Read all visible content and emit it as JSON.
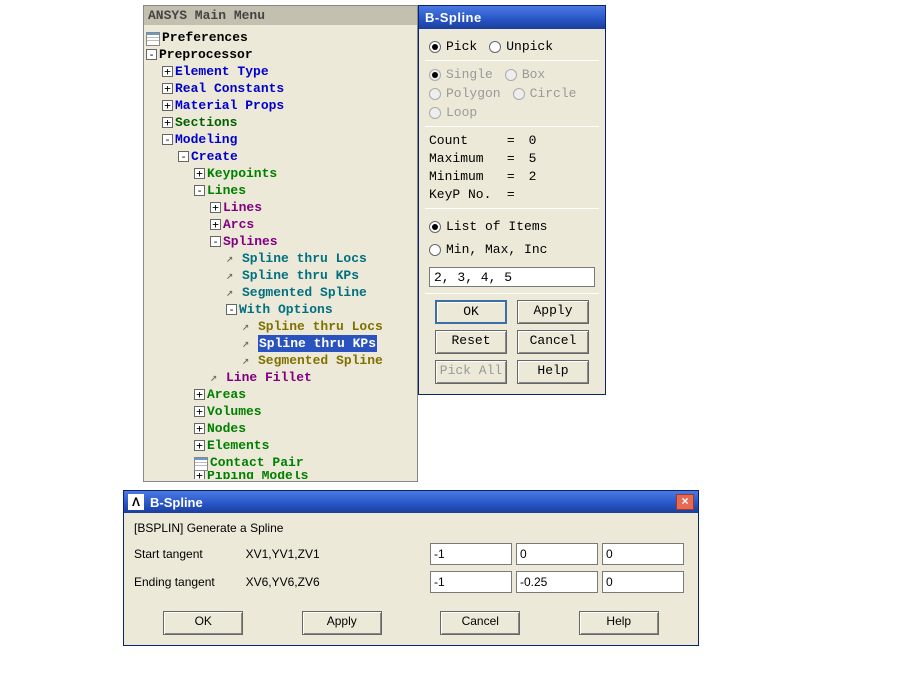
{
  "tree": {
    "title": "ANSYS Main Menu",
    "nodes": [
      {
        "depth": 0,
        "exp": "",
        "icon": "page",
        "label": "Preferences",
        "color": "c-black"
      },
      {
        "depth": 0,
        "exp": "-",
        "icon": "",
        "label": "Preprocessor",
        "color": "c-black"
      },
      {
        "depth": 1,
        "exp": "+",
        "icon": "",
        "label": "Element Type",
        "color": "c-blue"
      },
      {
        "depth": 1,
        "exp": "+",
        "icon": "",
        "label": "Real Constants",
        "color": "c-blue"
      },
      {
        "depth": 1,
        "exp": "+",
        "icon": "",
        "label": "Material Props",
        "color": "c-blue"
      },
      {
        "depth": 1,
        "exp": "+",
        "icon": "",
        "label": "Sections",
        "color": "c-darkgreen"
      },
      {
        "depth": 1,
        "exp": "-",
        "icon": "",
        "label": "Modeling",
        "color": "c-blue"
      },
      {
        "depth": 2,
        "exp": "-",
        "icon": "",
        "label": "Create",
        "color": "c-blue"
      },
      {
        "depth": 3,
        "exp": "+",
        "icon": "",
        "label": "Keypoints",
        "color": "c-green"
      },
      {
        "depth": 3,
        "exp": "-",
        "icon": "",
        "label": "Lines",
        "color": "c-green"
      },
      {
        "depth": 4,
        "exp": "+",
        "icon": "",
        "label": "Lines",
        "color": "c-purple"
      },
      {
        "depth": 4,
        "exp": "+",
        "icon": "",
        "label": "Arcs",
        "color": "c-purple"
      },
      {
        "depth": 4,
        "exp": "-",
        "icon": "",
        "label": "Splines",
        "color": "c-purple"
      },
      {
        "depth": 5,
        "exp": "",
        "icon": "arrow",
        "label": "Spline thru Locs",
        "color": "c-teal"
      },
      {
        "depth": 5,
        "exp": "",
        "icon": "arrow",
        "label": "Spline thru KPs",
        "color": "c-teal"
      },
      {
        "depth": 5,
        "exp": "",
        "icon": "arrow",
        "label": "Segmented Spline",
        "color": "c-teal"
      },
      {
        "depth": 5,
        "exp": "-",
        "icon": "",
        "label": "With Options",
        "color": "c-teal"
      },
      {
        "depth": 6,
        "exp": "",
        "icon": "arrow",
        "label": "Spline thru Locs",
        "color": "c-olive"
      },
      {
        "depth": 6,
        "exp": "",
        "icon": "arrow",
        "label": "Spline thru KPs",
        "color": "c-olive",
        "selected": true
      },
      {
        "depth": 6,
        "exp": "",
        "icon": "arrow",
        "label": "Segmented Spline",
        "color": "c-olive"
      },
      {
        "depth": 4,
        "exp": "",
        "icon": "arrow",
        "label": "Line Fillet",
        "color": "c-purple"
      },
      {
        "depth": 3,
        "exp": "+",
        "icon": "",
        "label": "Areas",
        "color": "c-green"
      },
      {
        "depth": 3,
        "exp": "+",
        "icon": "",
        "label": "Volumes",
        "color": "c-green"
      },
      {
        "depth": 3,
        "exp": "+",
        "icon": "",
        "label": "Nodes",
        "color": "c-green"
      },
      {
        "depth": 3,
        "exp": "+",
        "icon": "",
        "label": "Elements",
        "color": "c-green"
      },
      {
        "depth": 3,
        "exp": "",
        "icon": "page",
        "label": "Contact Pair",
        "color": "c-green"
      },
      {
        "depth": 3,
        "exp": "+",
        "icon": "",
        "label": "Piping Models",
        "color": "c-green",
        "cut": true
      }
    ]
  },
  "pick": {
    "title": "B-Spline",
    "mode": {
      "pick": "Pick",
      "unpick": "Unpick",
      "selected": "pick"
    },
    "shape": {
      "single": "Single",
      "box": "Box",
      "polygon": "Polygon",
      "circle": "Circle",
      "loop": "Loop",
      "disabled": true
    },
    "stats": {
      "count": {
        "label": "Count",
        "value": "0"
      },
      "maximum": {
        "label": "Maximum",
        "value": "5"
      },
      "minimum": {
        "label": "Minimum",
        "value": "2"
      },
      "keyp": {
        "label": "KeyP No.",
        "value": ""
      }
    },
    "listmode": {
      "list": "List of Items",
      "mmi": "Min, Max, Inc",
      "selected": "list"
    },
    "input_value": "2, 3, 4, 5",
    "buttons": {
      "ok": "OK",
      "apply": "Apply",
      "reset": "Reset",
      "cancel": "Cancel",
      "pickall": "Pick All",
      "help": "Help"
    }
  },
  "form": {
    "title": "B-Spline",
    "app_icon_letter": "Λ",
    "cmd": "[BSPLIN] Generate a Spline",
    "rows": [
      {
        "label1": "Start tangent",
        "label2": "XV1,YV1,ZV1",
        "v": [
          "-1",
          "0",
          "0"
        ]
      },
      {
        "label1": "Ending tangent",
        "label2": "XV6,YV6,ZV6",
        "v": [
          "-1",
          "-0.25",
          "0"
        ]
      }
    ],
    "buttons": {
      "ok": "OK",
      "apply": "Apply",
      "cancel": "Cancel",
      "help": "Help"
    }
  }
}
